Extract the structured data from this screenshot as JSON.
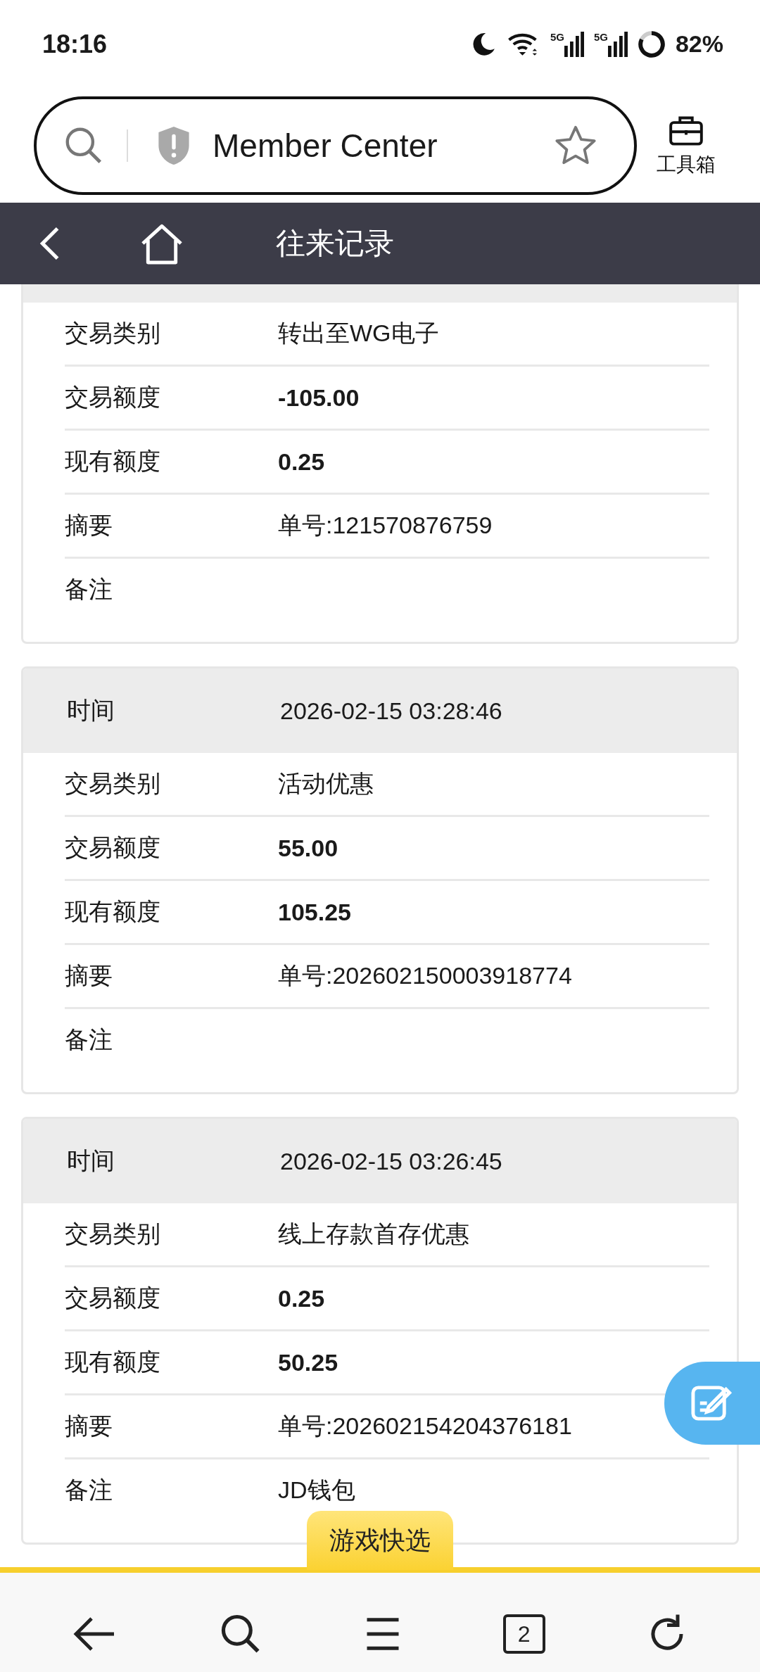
{
  "status_bar": {
    "time": "18:16",
    "signals": [
      {
        "label": "5G"
      },
      {
        "label": "5G"
      }
    ],
    "battery": "82%"
  },
  "address_bar": {
    "title": "Member Center",
    "toolbox_label": "工具箱"
  },
  "header": {
    "title": "往来记录"
  },
  "records": [
    {
      "rows": [
        {
          "kind": "text",
          "label": "交易类别",
          "value": "转出至WG电子"
        },
        {
          "kind": "amount",
          "label": "交易额度",
          "value": "-105.00"
        },
        {
          "kind": "amount",
          "label": "现有额度",
          "value": "0.25"
        },
        {
          "kind": "text",
          "label": "摘要",
          "value": "单号:121570876759"
        },
        {
          "kind": "text",
          "label": "备注"
        }
      ]
    },
    {
      "time_label": "时间",
      "time": "2026-02-15 03:28:46",
      "rows": [
        {
          "kind": "text",
          "label": "交易类别",
          "value": "活动优惠"
        },
        {
          "kind": "amount",
          "label": "交易额度",
          "value": "55.00"
        },
        {
          "kind": "amount",
          "label": "现有额度",
          "value": "105.25"
        },
        {
          "kind": "text",
          "label": "摘要",
          "value": "单号:202602150003918774"
        },
        {
          "kind": "text",
          "label": "备注"
        }
      ]
    },
    {
      "time_label": "时间",
      "time": "2026-02-15 03:26:45",
      "rows": [
        {
          "kind": "text",
          "label": "交易类别",
          "value": "线上存款首存优惠"
        },
        {
          "kind": "amount",
          "label": "交易额度",
          "value": "0.25"
        },
        {
          "kind": "amount",
          "label": "现有额度",
          "value": "50.25"
        },
        {
          "kind": "text",
          "label": "摘要",
          "value": "单号:202602154204376181"
        },
        {
          "kind": "text",
          "label": "备注",
          "value": "JD钱包"
        }
      ]
    }
  ],
  "quick_tab": "游戏快选",
  "bottom_bar": {
    "tab_count": "2"
  }
}
